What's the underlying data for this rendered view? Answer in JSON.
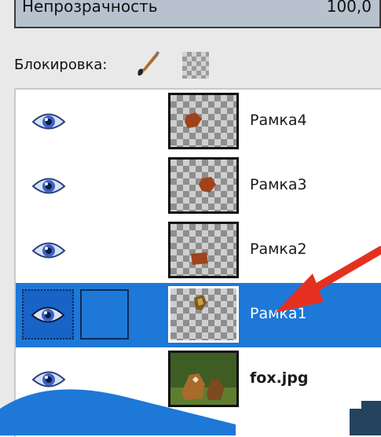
{
  "opacity": {
    "label": "Непрозрачность",
    "value": "100,0"
  },
  "lock": {
    "label": "Блокировка:",
    "icons": [
      "paintbrush-icon",
      "alpha-checker-icon"
    ]
  },
  "layers": [
    {
      "name": "Рамка4",
      "visible": true,
      "selected": false,
      "thumb": "transparent-with-brown-blob"
    },
    {
      "name": "Рамка3",
      "visible": true,
      "selected": false,
      "thumb": "transparent-with-brown-blob"
    },
    {
      "name": "Рамка2",
      "visible": true,
      "selected": false,
      "thumb": "transparent-with-brown-blob"
    },
    {
      "name": "Рамка1",
      "visible": true,
      "selected": true,
      "thumb": "transparent-with-small-fox"
    },
    {
      "name": "fox.jpg",
      "visible": true,
      "selected": false,
      "thumb": "fox-photo"
    }
  ],
  "colors": {
    "selection": "#1e78d8",
    "arrow": "#e6301f",
    "overlay_wave": "#1e78d8"
  }
}
